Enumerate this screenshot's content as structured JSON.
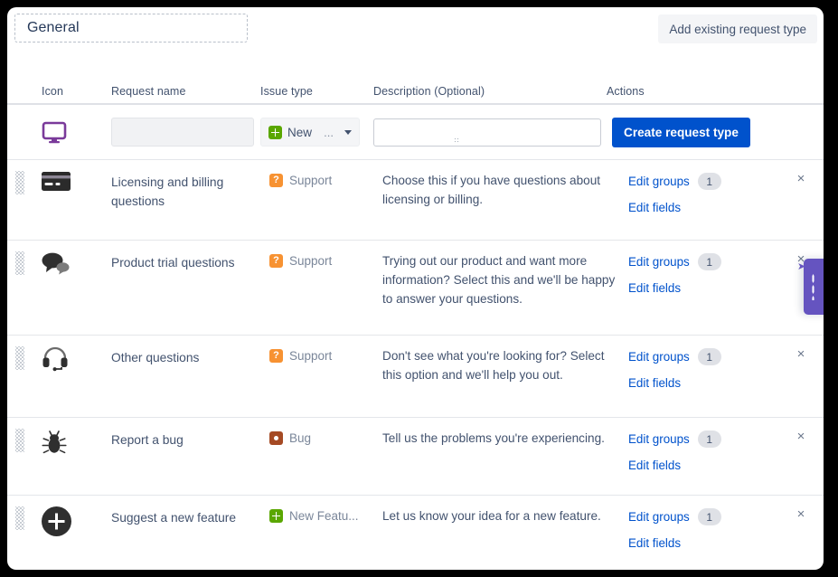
{
  "header": {
    "tab_label": "General",
    "add_existing_label": "Add existing request type"
  },
  "table": {
    "columns": {
      "icon": "Icon",
      "request_name": "Request name",
      "issue_type": "Issue type",
      "description": "Description (Optional)",
      "actions": "Actions"
    },
    "create_row": {
      "icon": "monitor-icon",
      "name_value": "",
      "name_placeholder": "",
      "issue_type_label": "New",
      "issue_type_ellipsis": "...",
      "issue_type_badge_color": "#5aa700",
      "description_value": "",
      "description_placeholder": "",
      "create_button_label": "Create request type"
    },
    "rows": [
      {
        "icon": "credit-card-icon",
        "name": "Licensing and billing questions",
        "issue_type": "Support",
        "issue_type_glyph": "?",
        "issue_type_color": "#f79232",
        "description": "Choose this if you have questions about licensing or billing.",
        "edit_groups_label": "Edit groups",
        "groups_count": "1",
        "edit_fields_label": "Edit fields",
        "remove_label": "×"
      },
      {
        "icon": "speech-bubbles-icon",
        "name": "Product trial questions",
        "issue_type": "Support",
        "issue_type_glyph": "?",
        "issue_type_color": "#f79232",
        "description": "Trying out our product and want more information? Select this and we'll be happy to answer your questions.",
        "edit_groups_label": "Edit groups",
        "groups_count": "1",
        "edit_fields_label": "Edit fields",
        "remove_label": "×"
      },
      {
        "icon": "headset-icon",
        "name": "Other questions",
        "issue_type": "Support",
        "issue_type_glyph": "?",
        "issue_type_color": "#f79232",
        "description": "Don't see what you're looking for? Select this option and we'll help you out.",
        "edit_groups_label": "Edit groups",
        "groups_count": "1",
        "edit_fields_label": "Edit fields",
        "remove_label": "×"
      },
      {
        "icon": "bug-icon",
        "name": "Report a bug",
        "issue_type": "Bug",
        "issue_type_glyph": "●",
        "issue_type_color": "#a54a24",
        "description": "Tell us the problems you're experiencing.",
        "edit_groups_label": "Edit groups",
        "groups_count": "1",
        "edit_fields_label": "Edit fields",
        "remove_label": "×"
      },
      {
        "icon": "plus-circle-icon",
        "name": "Suggest a new feature",
        "issue_type": "New Featu...",
        "issue_type_glyph": "+",
        "issue_type_color": "#5aa700",
        "description": "Let us know your idea for a new feature.",
        "edit_groups_label": "Edit groups",
        "groups_count": "1",
        "edit_fields_label": "Edit fields",
        "remove_label": "×"
      }
    ]
  },
  "feedback_tab": {
    "color": "#6554c0"
  }
}
